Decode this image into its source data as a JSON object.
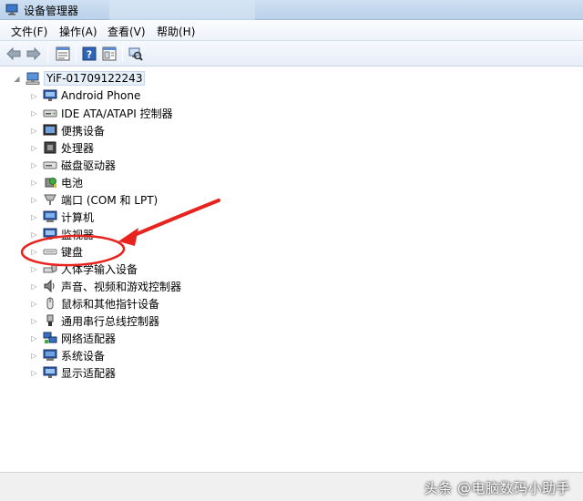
{
  "window": {
    "title": "设备管理器"
  },
  "menu": [
    {
      "label": "文件(F)"
    },
    {
      "label": "操作(A)"
    },
    {
      "label": "查看(V)"
    },
    {
      "label": "帮助(H)"
    }
  ],
  "toolbar": {
    "buttons": [
      {
        "icon": "back-arrow-icon"
      },
      {
        "icon": "forward-arrow-icon"
      },
      {
        "icon": "properties-icon"
      },
      {
        "icon": "help-icon"
      },
      {
        "icon": "action-pane-icon"
      },
      {
        "icon": "scan-hardware-icon"
      }
    ]
  },
  "tree": {
    "root": {
      "label": "YiF-01709122243",
      "icon": "computer-icon"
    },
    "children": [
      {
        "label": "Android Phone",
        "icon": "monitor-icon"
      },
      {
        "label": "IDE ATA/ATAPI 控制器",
        "icon": "drive-icon"
      },
      {
        "label": "便携设备",
        "icon": "portable-device-icon"
      },
      {
        "label": "处理器",
        "icon": "processor-icon"
      },
      {
        "label": "磁盘驱动器",
        "icon": "disk-drive-icon"
      },
      {
        "label": "电池",
        "icon": "battery-icon"
      },
      {
        "label": "端口 (COM 和 LPT)",
        "icon": "port-icon"
      },
      {
        "label": "计算机",
        "icon": "computer-icon"
      },
      {
        "label": "监视器",
        "icon": "monitor-icon"
      },
      {
        "label": "键盘",
        "icon": "keyboard-icon"
      },
      {
        "label": "人体学输入设备",
        "icon": "hid-icon"
      },
      {
        "label": "声音、视频和游戏控制器",
        "icon": "speaker-icon"
      },
      {
        "label": "鼠标和其他指针设备",
        "icon": "mouse-icon"
      },
      {
        "label": "通用串行总线控制器",
        "icon": "usb-icon"
      },
      {
        "label": "网络适配器",
        "icon": "network-icon"
      },
      {
        "label": "系统设备",
        "icon": "system-device-icon"
      },
      {
        "label": "显示适配器",
        "icon": "display-adapter-icon"
      }
    ]
  },
  "watermark": "头条 @电脑数码小助手",
  "annotation": {
    "color": "#e8231e",
    "target": "键盘"
  }
}
